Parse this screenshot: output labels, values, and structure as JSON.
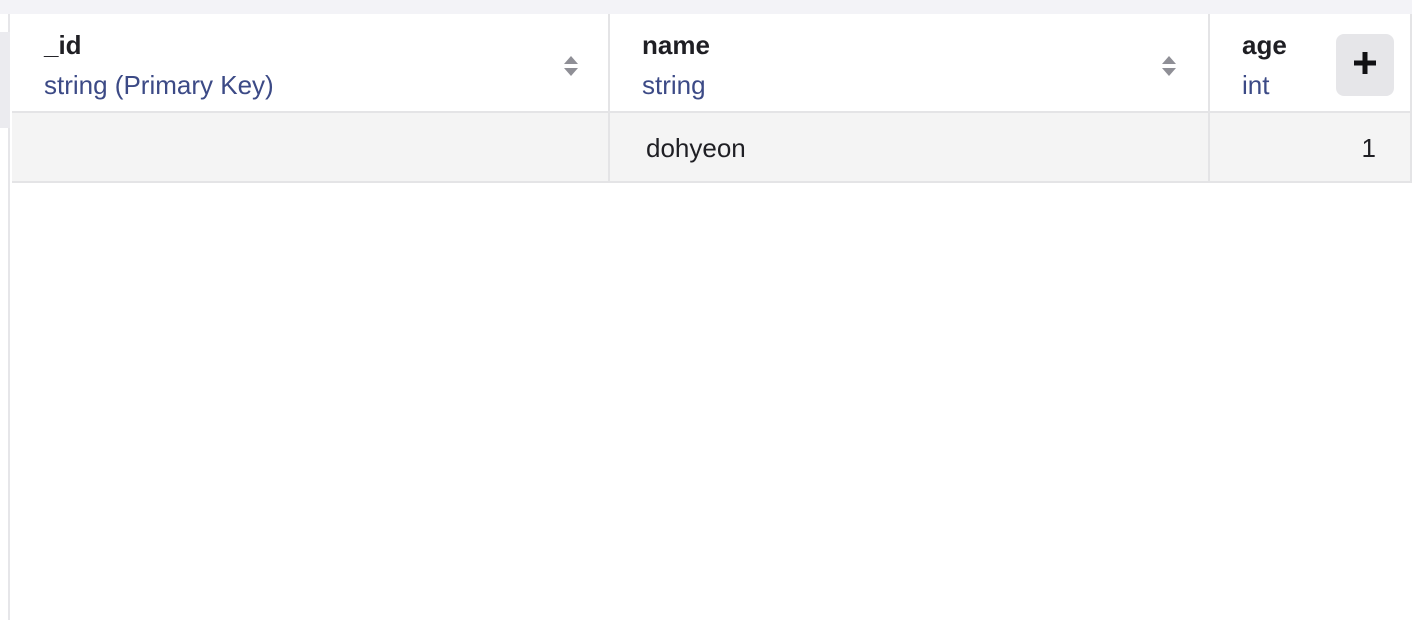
{
  "columns": [
    {
      "name": "_id",
      "type": "string (Primary Key)",
      "sortable": true
    },
    {
      "name": "name",
      "type": "string",
      "sortable": true
    },
    {
      "name": "age",
      "type": "int",
      "sortable": false
    }
  ],
  "rows": [
    {
      "_id": "",
      "name": "dohyeon",
      "age": "1"
    }
  ],
  "header_actions": {
    "add_column_icon": "plus-icon"
  },
  "colors": {
    "header_text": "#1f1f24",
    "type_text": "#3c4a86",
    "row_background": "#f4f4f4",
    "border": "#e4e4e6",
    "add_button_background": "#e6e6e9"
  }
}
